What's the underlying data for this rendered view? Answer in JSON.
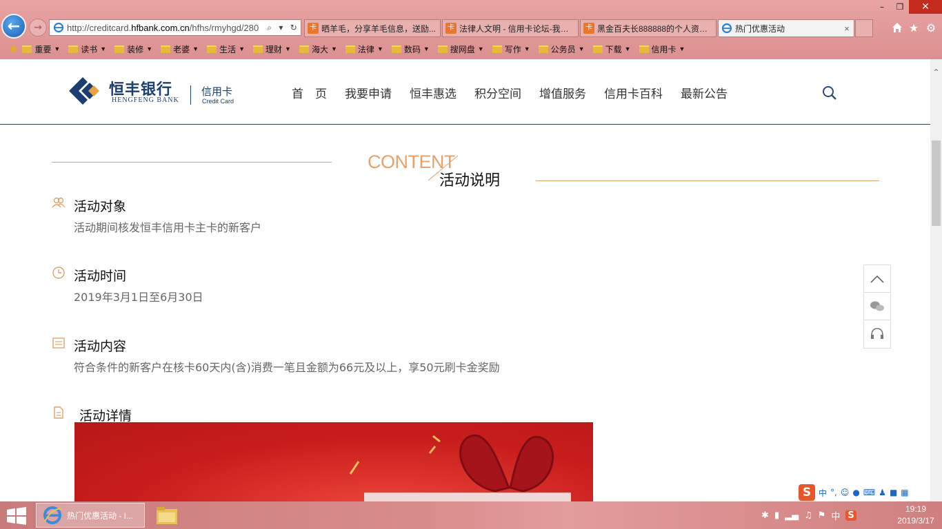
{
  "browser": {
    "address": {
      "prefix": "http://creditcard.",
      "domain": "hfbank.com.cn",
      "path": "/hfhs/rmyhgd/280"
    },
    "address_controls": {
      "search": "⌕",
      "dropdown": "▾",
      "refresh": "↻"
    },
    "tabs": [
      {
        "label": "晒羊毛，分享羊毛信息，送励...",
        "favicon": "卡"
      },
      {
        "label": "法律人文明 - 信用卡论坛-我爱...",
        "favicon": "卡"
      },
      {
        "label": "黑金百夫长888888的个人资料...",
        "favicon": "卡"
      },
      {
        "label": "热门优惠活动",
        "favicon": "ie-icon"
      }
    ],
    "active_tab_close": "×",
    "window_controls": {
      "minimize": "–",
      "restore": "❐",
      "close": "✕"
    },
    "favorites": [
      "重要",
      "读书",
      "装修",
      "老婆",
      "生活",
      "理财",
      "海大",
      "法律",
      "数码",
      "搜网盘",
      "写作",
      "公务员",
      "下载",
      "信用卡"
    ]
  },
  "site": {
    "logo_cn": "恒丰银行",
    "logo_en": "HENGFENG BANK",
    "card_cn": "信用卡",
    "card_en": "Credit Card",
    "nav": [
      "首　页",
      "我要申请",
      "恒丰惠选",
      "积分空间",
      "增值服务",
      "信用卡百科",
      "最新公告"
    ]
  },
  "heading": {
    "en": "CONTENT",
    "cn": "活动说明"
  },
  "sections": {
    "target": {
      "title": "活动对象",
      "desc": "活动期间核发恒丰信用卡主卡的新客户"
    },
    "time": {
      "title": "活动时间",
      "desc": "2019年3月1日至6月30日"
    },
    "content": {
      "title": "活动内容",
      "desc": "符合条件的新客户在核卡60天内(含)消费一笔且金额为66元及以上，享50元刷卡金奖励"
    },
    "details": {
      "title": "活动详情"
    }
  },
  "ime": {
    "mode": "中",
    "punct": "°,"
  },
  "taskbar": {
    "ie_label": "热门优惠活动 - I...",
    "tray_lang": "中",
    "time": "19:19",
    "date": "2019/3/17"
  },
  "colors": {
    "brand": "#1a3d73",
    "accent": "#e0a26a",
    "banner_red": "#c81c1c"
  }
}
